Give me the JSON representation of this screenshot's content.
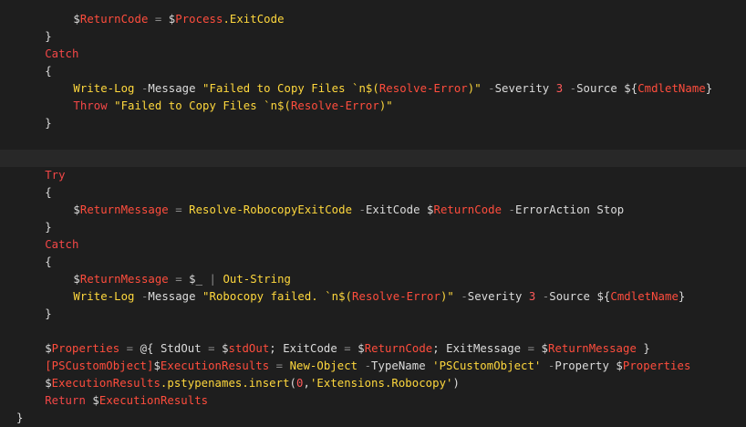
{
  "colors": {
    "background": "#1e1e1e",
    "current_line": "#282828",
    "default": "#dcdcdc",
    "keyword": "#f44747",
    "variable": "#ff4d3d",
    "cmdlet": "#ffd83d",
    "string": "#ffd83d",
    "operator": "#8a8a8a",
    "number": "#ff5a5a"
  },
  "editor": {
    "current_line_index": 8,
    "lines": [
      {
        "indent": 8,
        "tokens": [
          {
            "t": "$",
            "c": "default"
          },
          {
            "t": "ReturnCode",
            "c": "variable"
          },
          {
            "t": " = ",
            "c": "operator"
          },
          {
            "t": "$",
            "c": "default"
          },
          {
            "t": "Process",
            "c": "variable"
          },
          {
            "t": ".ExitCode",
            "c": "cmdlet"
          }
        ]
      },
      {
        "indent": 4,
        "tokens": [
          {
            "t": "}",
            "c": "default"
          }
        ]
      },
      {
        "indent": 4,
        "tokens": [
          {
            "t": "Catch",
            "c": "keyword"
          }
        ]
      },
      {
        "indent": 4,
        "tokens": [
          {
            "t": "{",
            "c": "default"
          }
        ]
      },
      {
        "indent": 8,
        "tokens": [
          {
            "t": "Write-Log",
            "c": "cmdlet"
          },
          {
            "t": " -",
            "c": "operator"
          },
          {
            "t": "Message ",
            "c": "default"
          },
          {
            "t": "\"Failed to Copy Files `n$(",
            "c": "string"
          },
          {
            "t": "Resolve-Error",
            "c": "variable"
          },
          {
            "t": ")\"",
            "c": "string"
          },
          {
            "t": " -",
            "c": "operator"
          },
          {
            "t": "Severity ",
            "c": "default"
          },
          {
            "t": "3",
            "c": "number"
          },
          {
            "t": " -",
            "c": "operator"
          },
          {
            "t": "Source ",
            "c": "default"
          },
          {
            "t": "${",
            "c": "default"
          },
          {
            "t": "CmdletName",
            "c": "variable"
          },
          {
            "t": "}",
            "c": "default"
          }
        ]
      },
      {
        "indent": 8,
        "tokens": [
          {
            "t": "Throw",
            "c": "keyword"
          },
          {
            "t": " ",
            "c": "default"
          },
          {
            "t": "\"Failed to Copy Files `n$(",
            "c": "string"
          },
          {
            "t": "Resolve-Error",
            "c": "variable"
          },
          {
            "t": ")\"",
            "c": "string"
          }
        ]
      },
      {
        "indent": 4,
        "tokens": [
          {
            "t": "}",
            "c": "default"
          }
        ]
      },
      {
        "indent": 0,
        "tokens": []
      },
      {
        "indent": 0,
        "tokens": []
      },
      {
        "indent": 4,
        "tokens": [
          {
            "t": "Try",
            "c": "keyword"
          }
        ]
      },
      {
        "indent": 4,
        "tokens": [
          {
            "t": "{",
            "c": "default"
          }
        ]
      },
      {
        "indent": 8,
        "tokens": [
          {
            "t": "$",
            "c": "default"
          },
          {
            "t": "ReturnMessage",
            "c": "variable"
          },
          {
            "t": " = ",
            "c": "operator"
          },
          {
            "t": "Resolve-RobocopyExitCode",
            "c": "cmdlet"
          },
          {
            "t": " -",
            "c": "operator"
          },
          {
            "t": "ExitCode ",
            "c": "default"
          },
          {
            "t": "$",
            "c": "default"
          },
          {
            "t": "ReturnCode",
            "c": "variable"
          },
          {
            "t": " -",
            "c": "operator"
          },
          {
            "t": "ErrorAction Stop",
            "c": "default"
          }
        ]
      },
      {
        "indent": 4,
        "tokens": [
          {
            "t": "}",
            "c": "default"
          }
        ]
      },
      {
        "indent": 4,
        "tokens": [
          {
            "t": "Catch",
            "c": "keyword"
          }
        ]
      },
      {
        "indent": 4,
        "tokens": [
          {
            "t": "{",
            "c": "default"
          }
        ]
      },
      {
        "indent": 8,
        "tokens": [
          {
            "t": "$",
            "c": "default"
          },
          {
            "t": "ReturnMessage",
            "c": "variable"
          },
          {
            "t": " = ",
            "c": "operator"
          },
          {
            "t": "$_",
            "c": "default"
          },
          {
            "t": " | ",
            "c": "operator"
          },
          {
            "t": "Out-String",
            "c": "cmdlet"
          }
        ]
      },
      {
        "indent": 8,
        "tokens": [
          {
            "t": "Write-Log",
            "c": "cmdlet"
          },
          {
            "t": " -",
            "c": "operator"
          },
          {
            "t": "Message ",
            "c": "default"
          },
          {
            "t": "\"Robocopy failed. `n$(",
            "c": "string"
          },
          {
            "t": "Resolve-Error",
            "c": "variable"
          },
          {
            "t": ")\"",
            "c": "string"
          },
          {
            "t": " -",
            "c": "operator"
          },
          {
            "t": "Severity ",
            "c": "default"
          },
          {
            "t": "3",
            "c": "number"
          },
          {
            "t": " -",
            "c": "operator"
          },
          {
            "t": "Source ",
            "c": "default"
          },
          {
            "t": "${",
            "c": "default"
          },
          {
            "t": "CmdletName",
            "c": "variable"
          },
          {
            "t": "}",
            "c": "default"
          }
        ]
      },
      {
        "indent": 4,
        "tokens": [
          {
            "t": "}",
            "c": "default"
          }
        ]
      },
      {
        "indent": 0,
        "tokens": []
      },
      {
        "indent": 4,
        "tokens": [
          {
            "t": "$",
            "c": "default"
          },
          {
            "t": "Properties",
            "c": "variable"
          },
          {
            "t": " = ",
            "c": "operator"
          },
          {
            "t": "@{",
            "c": "default"
          },
          {
            "t": " StdOut ",
            "c": "default"
          },
          {
            "t": "=",
            "c": "operator"
          },
          {
            "t": " ",
            "c": "default"
          },
          {
            "t": "$",
            "c": "default"
          },
          {
            "t": "stdOut",
            "c": "variable"
          },
          {
            "t": "; ExitCode ",
            "c": "default"
          },
          {
            "t": "=",
            "c": "operator"
          },
          {
            "t": " ",
            "c": "default"
          },
          {
            "t": "$",
            "c": "default"
          },
          {
            "t": "ReturnCode",
            "c": "variable"
          },
          {
            "t": "; ExitMessage ",
            "c": "default"
          },
          {
            "t": "=",
            "c": "operator"
          },
          {
            "t": " ",
            "c": "default"
          },
          {
            "t": "$",
            "c": "default"
          },
          {
            "t": "ReturnMessage",
            "c": "variable"
          },
          {
            "t": " }",
            "c": "default"
          }
        ]
      },
      {
        "indent": 4,
        "tokens": [
          {
            "t": "[PSCustomObject]",
            "c": "variable"
          },
          {
            "t": "$",
            "c": "default"
          },
          {
            "t": "ExecutionResults",
            "c": "variable"
          },
          {
            "t": " = ",
            "c": "operator"
          },
          {
            "t": "New-Object",
            "c": "cmdlet"
          },
          {
            "t": " -",
            "c": "operator"
          },
          {
            "t": "TypeName ",
            "c": "default"
          },
          {
            "t": "'PSCustomObject'",
            "c": "string"
          },
          {
            "t": " -",
            "c": "operator"
          },
          {
            "t": "Property ",
            "c": "default"
          },
          {
            "t": "$",
            "c": "default"
          },
          {
            "t": "Properties",
            "c": "variable"
          }
        ]
      },
      {
        "indent": 4,
        "tokens": [
          {
            "t": "$",
            "c": "default"
          },
          {
            "t": "ExecutionResults",
            "c": "variable"
          },
          {
            "t": ".pstypenames.insert",
            "c": "cmdlet"
          },
          {
            "t": "(",
            "c": "default"
          },
          {
            "t": "0",
            "c": "number"
          },
          {
            "t": ",",
            "c": "default"
          },
          {
            "t": "'Extensions.Robocopy'",
            "c": "string"
          },
          {
            "t": ")",
            "c": "default"
          }
        ]
      },
      {
        "indent": 4,
        "tokens": [
          {
            "t": "Return",
            "c": "keyword"
          },
          {
            "t": " ",
            "c": "default"
          },
          {
            "t": "$",
            "c": "default"
          },
          {
            "t": "ExecutionResults",
            "c": "variable"
          }
        ]
      },
      {
        "indent": 0,
        "tokens": [
          {
            "t": "}",
            "c": "default"
          }
        ]
      }
    ]
  }
}
